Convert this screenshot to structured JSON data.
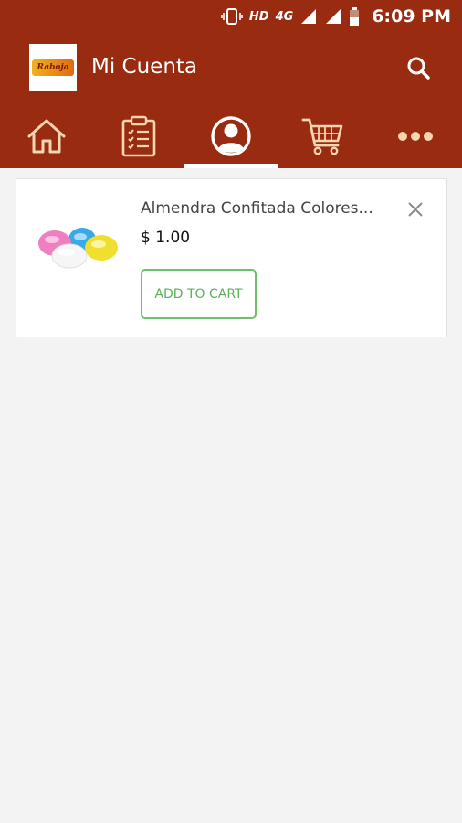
{
  "status_bar": {
    "hd": "HD",
    "network": "4G",
    "time": "6:09 PM"
  },
  "app_bar": {
    "logo_text": "Raboja",
    "title": "Mi Cuenta",
    "search_icon": "search-icon"
  },
  "nav": {
    "items": [
      {
        "icon": "home-icon",
        "active": false
      },
      {
        "icon": "clipboard-list-icon",
        "active": false
      },
      {
        "icon": "account-icon",
        "active": true
      },
      {
        "icon": "cart-icon",
        "active": false
      },
      {
        "icon": "more-icon",
        "active": false
      }
    ]
  },
  "wishlist": {
    "items": [
      {
        "name": "Almendra Confitada Colores...",
        "price": "$ 1.00",
        "add_label": "ADD TO CART",
        "image_icon": "candied-almonds-image"
      }
    ]
  },
  "colors": {
    "primary": "#982b10",
    "nav_icon": "#f6d6b0",
    "add_button": "#5daf58",
    "background": "#f3f3f3"
  }
}
